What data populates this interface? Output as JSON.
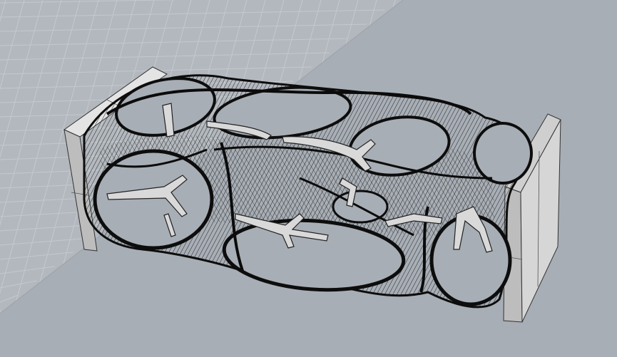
{
  "viewport": {
    "view": "perspective",
    "background_color": "#a8aeb5",
    "grid_color": "#c4c9ce",
    "grid_visible": true
  },
  "model": {
    "shape": "lattice-body",
    "mesh_color": "#111111",
    "core_color": "#d9d9d9",
    "plate_color": "#cfcfcf"
  }
}
